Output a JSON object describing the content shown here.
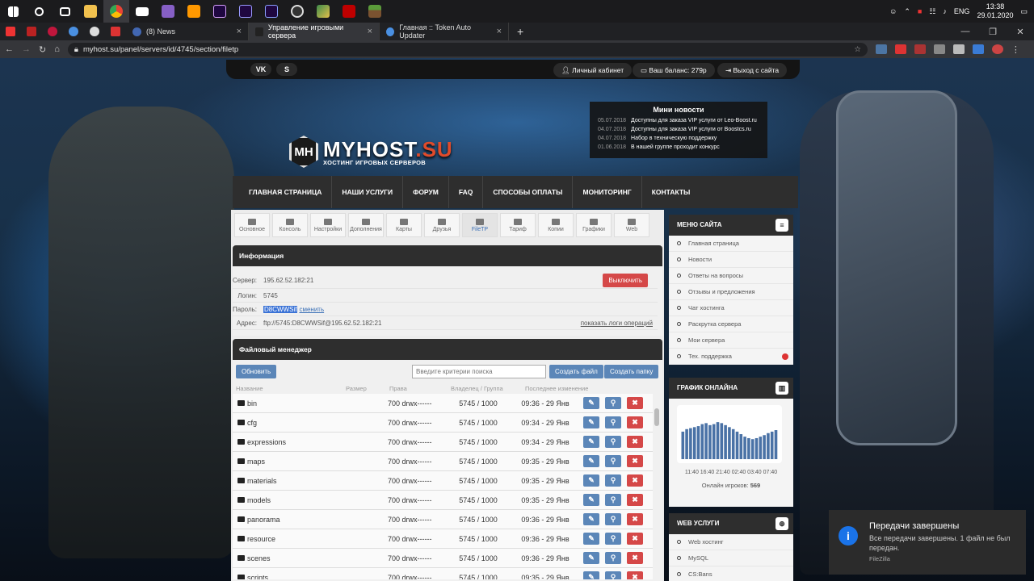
{
  "taskbar": {
    "apps": [
      "windows",
      "search",
      "task-view",
      "explorer",
      "chrome",
      "mail",
      "visual-studio",
      "sublime",
      "after-effects",
      "premiere",
      "media-encoder",
      "obs",
      "photoshop-like",
      "filezilla",
      "minecraft"
    ],
    "tray": {
      "lang": "ENG",
      "time": "13:38",
      "date": "29.01.2020"
    }
  },
  "browser": {
    "tabs": [
      {
        "title": "(8) News",
        "active": false
      },
      {
        "title": "Управление игровыми сервера",
        "active": true
      },
      {
        "title": "Главная :: Token Auto Updater",
        "active": false
      }
    ],
    "new_tab": "+",
    "url": "myhost.su/panel/servers/id/4745/section/filetp"
  },
  "site": {
    "top": {
      "social": [
        "VK",
        "S"
      ],
      "cabinet": "Личный кабинет",
      "balance": "Ваш баланс: 279р",
      "logout": "Выход с сайта"
    },
    "logo": {
      "my": "MYHOST",
      "su": ".SU",
      "mark": "MH",
      "tagline": "ХОСТИНГ ИГРОВЫХ СЕРВЕРОВ"
    },
    "news": {
      "title": "Мини новости",
      "items": [
        {
          "date": "05.07.2018",
          "text": "Доступны для заказа VIP услуги от Leo-Boost.ru"
        },
        {
          "date": "04.07.2018",
          "text": "Доступны для заказа VIP услуги от Boostcs.ru"
        },
        {
          "date": "04.07.2018",
          "text": "Набор в техническую поддержку"
        },
        {
          "date": "01.06.2018",
          "text": "В нашей группе проходит конкурс"
        }
      ]
    },
    "nav": [
      "ГЛАВНАЯ СТРАНИЦА",
      "НАШИ УСЛУГИ",
      "ФОРУМ",
      "FAQ",
      "СПОСОБЫ ОПЛАТЫ",
      "МОНИТОРИНГ",
      "КОНТАКТЫ"
    ],
    "subtabs": [
      "Основное",
      "Консоль",
      "Настройки",
      "Дополнения",
      "Карты",
      "Друзья",
      "FileTP",
      "Тариф",
      "Копии",
      "Графики",
      "Web"
    ],
    "info": {
      "title": "Информация",
      "server_label": "Сервер:",
      "server": "195.62.52.182:21",
      "login_label": "Логин:",
      "login": "5745",
      "pass_label": "Пароль:",
      "pass": "D8CWWSif",
      "change": "сменить",
      "addr_label": "Адрес:",
      "addr": "ftp://5745:D8CWWSif@195.62.52.182:21",
      "logs": "показать логи операций",
      "disable": "Выключить"
    },
    "fm": {
      "title": "Файловый менеджер",
      "refresh": "Обновить",
      "search_placeholder": "Введите критерии поиска",
      "create_file": "Создать файл",
      "create_folder": "Создать папку",
      "cols": [
        "Название",
        "Размер",
        "Права",
        "Владелец / Группа",
        "Последнее изменение"
      ],
      "rows": [
        {
          "name": "bin",
          "perm": "700 drwx------",
          "owner": "5745 / 1000",
          "mod": "09:36 - 29 Янв"
        },
        {
          "name": "cfg",
          "perm": "700 drwx------",
          "owner": "5745 / 1000",
          "mod": "09:34 - 29 Янв"
        },
        {
          "name": "expressions",
          "perm": "700 drwx------",
          "owner": "5745 / 1000",
          "mod": "09:34 - 29 Янв"
        },
        {
          "name": "maps",
          "perm": "700 drwx------",
          "owner": "5745 / 1000",
          "mod": "09:35 - 29 Янв"
        },
        {
          "name": "materials",
          "perm": "700 drwx------",
          "owner": "5745 / 1000",
          "mod": "09:35 - 29 Янв"
        },
        {
          "name": "models",
          "perm": "700 drwx------",
          "owner": "5745 / 1000",
          "mod": "09:35 - 29 Янв"
        },
        {
          "name": "panorama",
          "perm": "700 drwx------",
          "owner": "5745 / 1000",
          "mod": "09:36 - 29 Янв"
        },
        {
          "name": "resource",
          "perm": "700 drwx------",
          "owner": "5745 / 1000",
          "mod": "09:36 - 29 Янв"
        },
        {
          "name": "scenes",
          "perm": "700 drwx------",
          "owner": "5745 / 1000",
          "mod": "09:36 - 29 Янв"
        },
        {
          "name": "scripts",
          "perm": "700 drwx------",
          "owner": "5745 / 1000",
          "mod": "09:35 - 29 Янв"
        }
      ]
    },
    "menu": {
      "title": "МЕНЮ САЙТА",
      "items": [
        "Главная страница",
        "Новости",
        "Ответы на вопросы",
        "Отзывы и предложения",
        "Чат хостинга",
        "Раскрутка сервера",
        "Мои сервера",
        "Тех. поддержка"
      ]
    },
    "online": {
      "title": "ГРАФИК ОНЛАЙНА",
      "axis": "11:40 16:40 21:40 02:40 03:40 07:40",
      "label": "Онлайн игроков:",
      "value": "569"
    },
    "web": {
      "title": "WEB УСЛУГИ",
      "items": [
        "Web хостинг",
        "MySQL",
        "CS:Bans"
      ]
    }
  },
  "toast": {
    "title": "Передачи завершены",
    "body": "Все передачи завершены. 1 файл не был передан.",
    "source": "FileZilla"
  },
  "colors": {
    "accent": "#5b86b8",
    "danger": "#d54848",
    "dark": "#2e2e2e",
    "logo_red": "#e04b2b"
  },
  "chart_data": {
    "type": "bar",
    "values": [
      55,
      60,
      62,
      64,
      66,
      70,
      72,
      68,
      70,
      74,
      72,
      68,
      64,
      60,
      55,
      50,
      45,
      42,
      40,
      42,
      45,
      48,
      52,
      55,
      58
    ],
    "series": [
      {
        "name": "Онлайн игроков",
        "values": [
          55,
          60,
          62,
          64,
          66,
          70,
          72,
          68,
          70,
          74,
          72,
          68,
          64,
          60,
          55,
          50,
          45,
          42,
          40,
          42,
          45,
          48,
          52,
          55,
          58
        ]
      }
    ]
  }
}
